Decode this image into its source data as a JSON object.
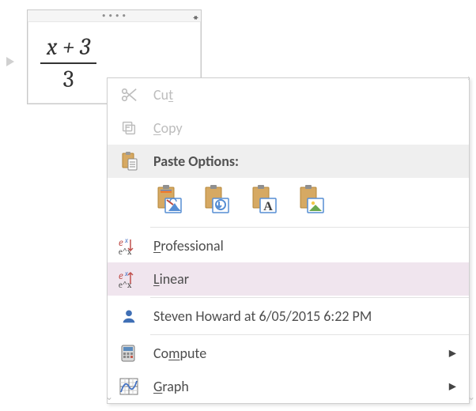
{
  "equation": {
    "numerator": "x + 3",
    "denominator": "3"
  },
  "context_menu": {
    "cut": {
      "label": "Cut",
      "accel_index": 2
    },
    "copy": {
      "label": "Copy",
      "accel_index": 0
    },
    "paste_options_label": "Paste Options:",
    "professional": {
      "label": "Professional",
      "accel_index": 0
    },
    "linear": {
      "label": "Linear",
      "accel_index": 0
    },
    "author_line": "Steven Howard at 6/05/2015 6:22 PM",
    "compute": {
      "label": "Compute",
      "accel_index": 2
    },
    "graph": {
      "label": "Graph",
      "accel_index": 0
    }
  }
}
